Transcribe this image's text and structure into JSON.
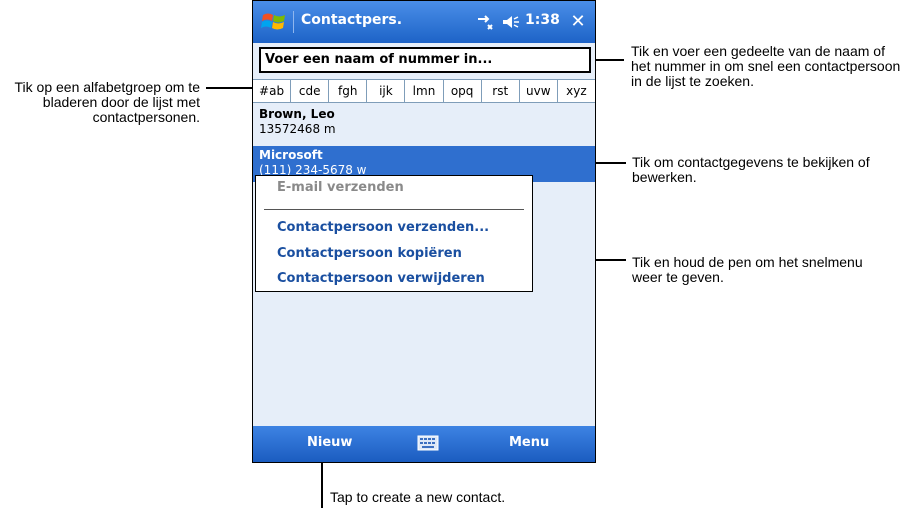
{
  "device": {
    "title": "Contactpers.",
    "clock": "1:38",
    "close_glyph": "✕",
    "icons": [
      "windows-start-icon",
      "connectivity-icon",
      "volume-icon",
      "close-icon",
      "keyboard-icon"
    ],
    "accent_color": "#2f6fcf",
    "search_value": "Voer een naam of nummer in...",
    "alpha_groups": [
      "#ab",
      "cde",
      "fgh",
      "ijk",
      "lmn",
      "opq",
      "rst",
      "uvw",
      "xyz"
    ],
    "contacts": [
      {
        "name": "Brown, Leo",
        "detail": "13572468   m"
      },
      {
        "name": "Microsoft",
        "detail": "(111) 234-5678   w"
      }
    ],
    "context_menu": {
      "send_email": "E-mail verzenden",
      "send_contact": "Contactpersoon verzenden...",
      "copy_contact": "Contactpersoon kopiëren",
      "delete_contact": "Contactpersoon verwijderen"
    },
    "bottom_bar": {
      "new_label": "Nieuw",
      "menu_label": "Menu"
    }
  },
  "callouts": {
    "alphabet_group": "Tik op een alfabetgroep om te bladeren door de lijst met contactpersonen.",
    "search": "Tik en voer een gedeelte van de naam of het nummer in om snel een contactpersoon in de lijst te zoeken.",
    "view_edit": "Tik om contactgegevens te bekijken of bewerken.",
    "tap_hold": "Tik en houd de pen om het snelmenu weer te geven.",
    "new_contact": "Tap to create a new contact."
  }
}
